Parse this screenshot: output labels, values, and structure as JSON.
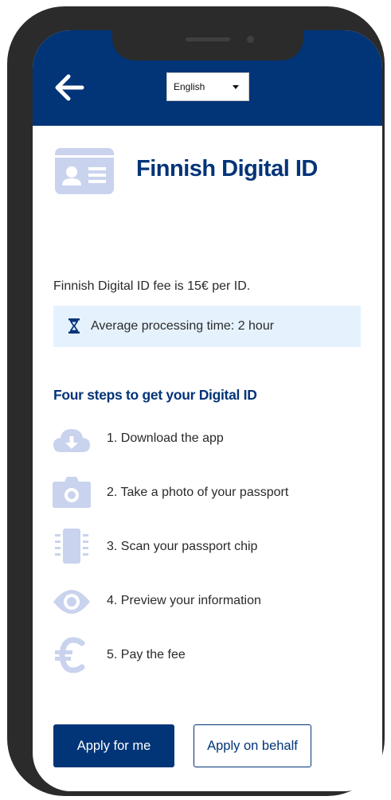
{
  "header": {
    "back_icon": "arrow-left-icon",
    "language": {
      "selected": "English",
      "icon": "caret-down-icon"
    }
  },
  "page": {
    "title": "Finnish Digital ID",
    "title_icon": "id-card-icon",
    "fee_text": "Finnish Digital ID fee is 15€ per ID.",
    "processing": {
      "icon": "hourglass-icon",
      "text": "Average processing time: 2 hour"
    }
  },
  "steps": {
    "heading": "Four steps to get your Digital ID",
    "items": [
      {
        "icon": "cloud-download-icon",
        "label": "1. Download the app"
      },
      {
        "icon": "camera-icon",
        "label": "2. Take a photo of your passport"
      },
      {
        "icon": "chip-icon",
        "label": "3. Scan your passport chip"
      },
      {
        "icon": "eye-icon",
        "label": "4. Preview your information"
      },
      {
        "icon": "euro-icon",
        "label": "5. Pay the fee"
      }
    ]
  },
  "actions": {
    "primary": "Apply for me",
    "secondary": "Apply on behalf"
  },
  "colors": {
    "brand": "#023478",
    "icon_light": "#c9d3ee",
    "info_bg": "#e5f2fe",
    "frame": "#2b2b2b"
  }
}
